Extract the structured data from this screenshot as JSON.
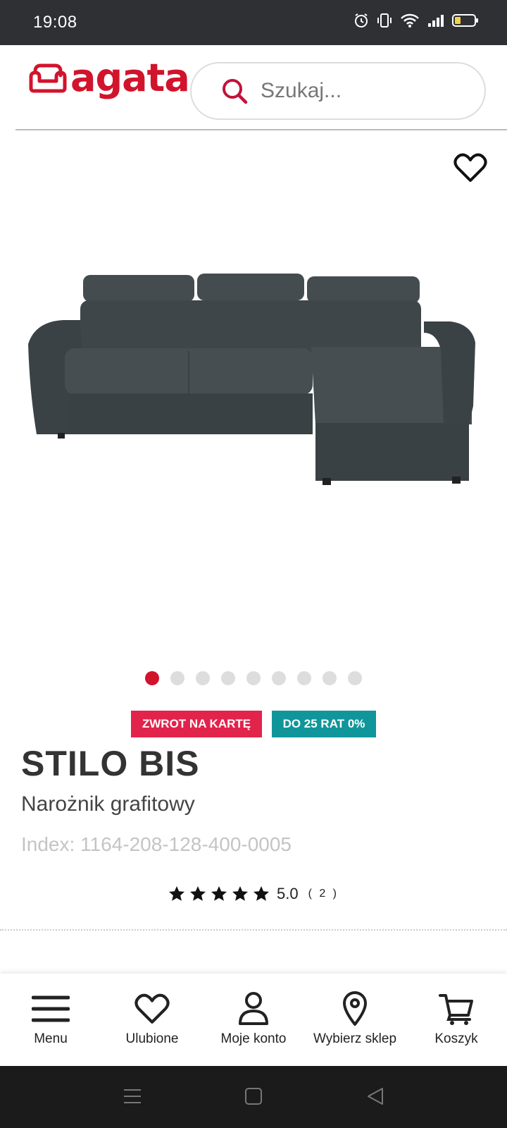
{
  "status_bar": {
    "time": "19:08"
  },
  "header": {
    "logo_text": "agata",
    "search_placeholder": "Szukaj..."
  },
  "carousel": {
    "total": 9,
    "active": 0
  },
  "badges": [
    {
      "label": "ZWROT NA KARTĘ",
      "color": "#e2234b"
    },
    {
      "label": "DO 25 RAT 0%",
      "color": "#10969a"
    }
  ],
  "product": {
    "title": "STILO BIS",
    "subtitle": "Narożnik grafitowy",
    "index": "Index: 1164-208-128-400-0005",
    "rating": "5.0",
    "rating_count": "( 2 )",
    "stars": 5
  },
  "bottom_nav": [
    {
      "label": "Menu",
      "icon": "menu-icon"
    },
    {
      "label": "Ulubione",
      "icon": "heart-icon"
    },
    {
      "label": "Moje konto",
      "icon": "user-icon"
    },
    {
      "label": "Wybierz sklep",
      "icon": "location-pin-icon"
    },
    {
      "label": "Koszyk",
      "icon": "cart-icon"
    }
  ],
  "colors": {
    "brand_red": "#d2132c",
    "teal": "#10969a",
    "sofa": "#3d4447"
  }
}
